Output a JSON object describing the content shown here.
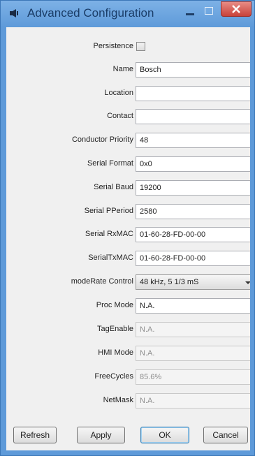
{
  "window": {
    "title": "Advanced Configuration"
  },
  "form": {
    "persistence": {
      "label": "Persistence",
      "checked": false
    },
    "name": {
      "label": "Name",
      "value": "Bosch"
    },
    "location": {
      "label": "Location",
      "value": ""
    },
    "contact": {
      "label": "Contact",
      "value": ""
    },
    "conductor_priority": {
      "label": "Conductor Priority",
      "value": "48"
    },
    "serial_format": {
      "label": "Serial Format",
      "value": "0x0"
    },
    "serial_baud": {
      "label": "Serial Baud",
      "value": "19200"
    },
    "serial_pperiod": {
      "label": "Serial PPeriod",
      "value": "2580"
    },
    "serial_rxmac": {
      "label": "Serial RxMAC",
      "value": "01-60-28-FD-00-00"
    },
    "serial_txmac": {
      "label": "SerialTxMAC",
      "value": "01-60-28-FD-00-00"
    },
    "moderate_control": {
      "label": "modeRate Control",
      "value": "48 kHz, 5 1/3 mS"
    },
    "proc_mode": {
      "label": "Proc Mode",
      "value": "N.A."
    },
    "tag_enable": {
      "label": "TagEnable",
      "value": "N.A."
    },
    "hmi_mode": {
      "label": "HMI Mode",
      "value": "N.A."
    },
    "free_cycles": {
      "label": "FreeCycles",
      "value": "85.6%"
    },
    "net_mask": {
      "label": "NetMask",
      "value": "N.A."
    }
  },
  "buttons": {
    "refresh": "Refresh",
    "apply": "Apply",
    "ok": "OK",
    "cancel": "Cancel"
  },
  "colors": {
    "title_bar": "#5e9ad9",
    "close_button": "#c8423a",
    "dialog_background": "#f0f0f0"
  }
}
